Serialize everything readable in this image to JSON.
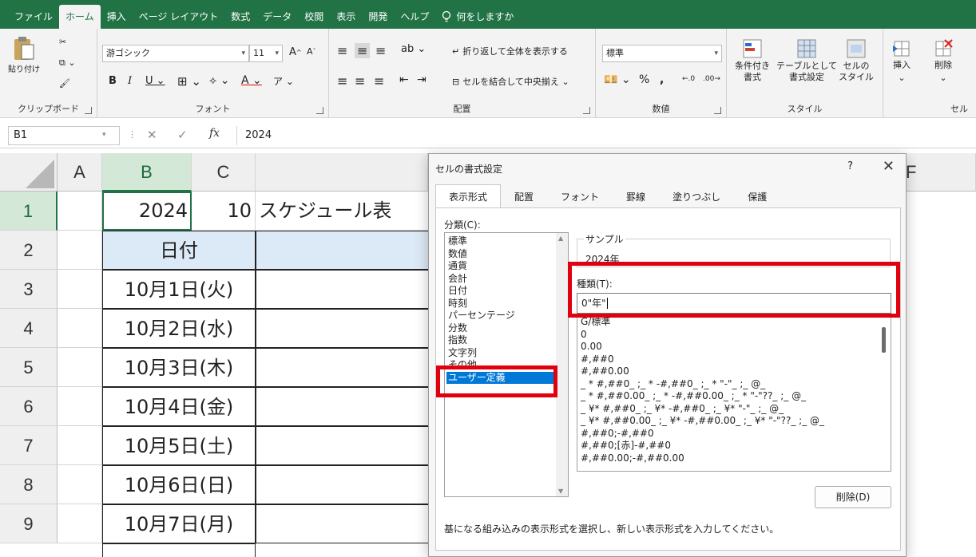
{
  "menu": {
    "tabs": [
      "ファイル",
      "ホーム",
      "挿入",
      "ページ レイアウト",
      "数式",
      "データ",
      "校閲",
      "表示",
      "開発",
      "ヘルプ"
    ],
    "active_tab": "ホーム",
    "tell_me": "何をしますか"
  },
  "ribbon": {
    "clipboard": {
      "paste": "貼り付け",
      "label": "クリップボード"
    },
    "font": {
      "name": "游ゴシック",
      "size": "11",
      "bold": "B",
      "italic": "I",
      "underline": "U",
      "grow": "A",
      "shrink": "A",
      "color_letter": "A",
      "label": "フォント"
    },
    "alignment": {
      "wrap": "折り返して全体を表示する",
      "merge": "セルを結合して中央揃え",
      "label": "配置"
    },
    "number": {
      "format": "標準",
      "percent": "%",
      "comma": ",",
      "label": "数値"
    },
    "styles": {
      "cond": "条件付き\n書式",
      "table": "テーブルとして\n書式設定",
      "cell": "セルの\nスタイル",
      "cond_l1": "条件付き",
      "cond_l2": "書式",
      "table_l1": "テーブルとして",
      "table_l2": "書式設定",
      "cell_l1": "セルの",
      "cell_l2": "スタイル",
      "label": "スタイル"
    },
    "cells": {
      "insert": "挿入",
      "delete": "削除",
      "label": "セル"
    }
  },
  "formula_bar": {
    "name_box": "B1",
    "fx": "fx",
    "value": "2024"
  },
  "sheet": {
    "columns": [
      "A",
      "B",
      "C"
    ],
    "hidden_col_fragment": "F",
    "rows": [
      "1",
      "2",
      "3",
      "4",
      "5",
      "6",
      "7",
      "8",
      "9"
    ],
    "b1": "2024",
    "c1": "10",
    "d1": "スケジュール表",
    "b2": "日付",
    "dates": [
      "10月1日(火)",
      "10月2日(水)",
      "10月3日(木)",
      "10月4日(金)",
      "10月5日(土)",
      "10月6日(日)",
      "10月7日(月)"
    ]
  },
  "dialog": {
    "title": "セルの書式設定",
    "help": "?",
    "close": "✕",
    "tabs": [
      "表示形式",
      "配置",
      "フォント",
      "罫線",
      "塗りつぶし",
      "保護"
    ],
    "category_label": "分類(C):",
    "categories": [
      "標準",
      "数値",
      "通貨",
      "会計",
      "日付",
      "時刻",
      "パーセンテージ",
      "分数",
      "指数",
      "文字列",
      "その他",
      "ユーザー定義"
    ],
    "selected_category": "ユーザー定義",
    "sample_label": "サンプル",
    "sample_value": "2024年",
    "type_label": "種類(T):",
    "type_value": "0\"年\"",
    "formats": [
      "G/標準",
      "0",
      "0.00",
      "#,##0",
      "#,##0.00",
      "_ * #,##0_ ;_ * -#,##0_ ;_ * \"-\"_ ;_ @_",
      "_ * #,##0.00_ ;_ * -#,##0.00_ ;_ * \"-\"??_ ;_ @_",
      "_ ¥* #,##0_ ;_ ¥* -#,##0_ ;_ ¥* \"-\"_ ;_ @_",
      "_ ¥* #,##0.00_ ;_ ¥* -#,##0.00_ ;_ ¥* \"-\"??_ ;_ @_",
      "#,##0;-#,##0",
      "#,##0;[赤]-#,##0",
      "#,##0.00;-#,##0.00"
    ],
    "delete_button": "削除(D)",
    "description": "基になる組み込みの表示形式を選択し、新しい表示形式を入力してください。"
  },
  "colors": {
    "excel_green": "#217346",
    "highlight_red": "#e0000f",
    "selection_blue": "#0078d7",
    "header_fill": "#dce9f6"
  }
}
